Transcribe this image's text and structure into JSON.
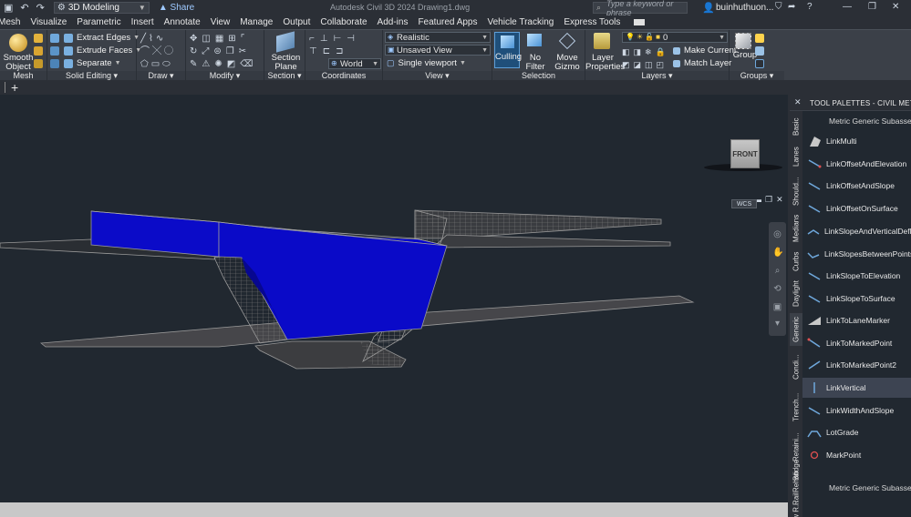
{
  "titlebar": {
    "workspace": "3D Modeling",
    "share": "Share",
    "app_title": "Autodesk Civil 3D 2024   Drawing1.dwg",
    "search_placeholder": "Type a keyword or phrase",
    "username": "buinhuthuon..."
  },
  "menu": [
    "Mesh",
    "Visualize",
    "Parametric",
    "Insert",
    "Annotate",
    "View",
    "Manage",
    "Output",
    "Collaborate",
    "Add-ins",
    "Featured Apps",
    "Vehicle Tracking",
    "Express Tools"
  ],
  "ribbon": {
    "mesh": {
      "title": "Mesh",
      "smooth_object": "Smooth\nObject"
    },
    "solid_editing": {
      "title": "Solid Editing",
      "extract_edges": "Extract Edges",
      "extrude_faces": "Extrude Faces",
      "separate": "Separate"
    },
    "draw": {
      "title": "Draw"
    },
    "modify": {
      "title": "Modify"
    },
    "section": {
      "title": "Section",
      "section_plane": "Section\nPlane"
    },
    "coordinates": {
      "title": "Coordinates",
      "world": "World"
    },
    "view": {
      "title": "View",
      "visual_style": "Realistic",
      "named_view": "Unsaved View",
      "viewport": "Single viewport"
    },
    "selection": {
      "title": "Selection",
      "culling": "Culling",
      "no_filter": "No Filter",
      "move_gizmo": "Move\nGizmo"
    },
    "layers": {
      "title": "Layers",
      "layer_properties": "Layer\nProperties",
      "layer_name": "0",
      "make_current": "Make Current",
      "match_layer": "Match Layer"
    },
    "groups": {
      "title": "Groups",
      "group": "Group"
    }
  },
  "viewport": {
    "viewcube_face": "FRONT",
    "wcs": "WCS"
  },
  "palette": {
    "title": "TOOL PALETTES - CIVIL METRIC S...",
    "section_title": "Metric Generic Subassemblies",
    "section_title_bottom": "Metric Generic Subassemblies",
    "tabs": [
      "Basic",
      "Lanes",
      "Should...",
      "Medians",
      "Curbs",
      "Daylight",
      "Generic",
      "Condi...",
      "Trench...",
      "Retaini...",
      "Rehab",
      "New R...",
      "Bridge",
      "Rail"
    ],
    "items": [
      {
        "label": "LinkMulti",
        "icon": "link-multi-icon"
      },
      {
        "label": "LinkOffsetAndElevation",
        "icon": "link-offset-elevation-icon"
      },
      {
        "label": "LinkOffsetAndSlope",
        "icon": "link-offset-slope-icon"
      },
      {
        "label": "LinkOffsetOnSurface",
        "icon": "link-offset-surface-icon"
      },
      {
        "label": "LinkSlopeAndVerticalDeflection",
        "icon": "link-slope-vertical-icon"
      },
      {
        "label": "LinkSlopesBetweenPoints",
        "icon": "link-slopes-points-icon"
      },
      {
        "label": "LinkSlopeToElevation",
        "icon": "link-slope-elevation-icon"
      },
      {
        "label": "LinkSlopeToSurface",
        "icon": "link-slope-surface-icon"
      },
      {
        "label": "LinkToLaneMarker",
        "icon": "link-lane-marker-icon"
      },
      {
        "label": "LinkToMarkedPoint",
        "icon": "link-marked-point-icon"
      },
      {
        "label": "LinkToMarkedPoint2",
        "icon": "link-marked-point2-icon"
      },
      {
        "label": "LinkVertical",
        "icon": "link-vertical-icon"
      },
      {
        "label": "LinkWidthAndSlope",
        "icon": "link-width-slope-icon"
      },
      {
        "label": "LotGrade",
        "icon": "lot-grade-icon"
      },
      {
        "label": "MarkPoint",
        "icon": "mark-point-icon"
      }
    ]
  },
  "colors": {
    "background": "#212830",
    "solid_fill": "#0a0ac8",
    "panel": "#3b4048",
    "accent_link": "#9ec9ff"
  }
}
